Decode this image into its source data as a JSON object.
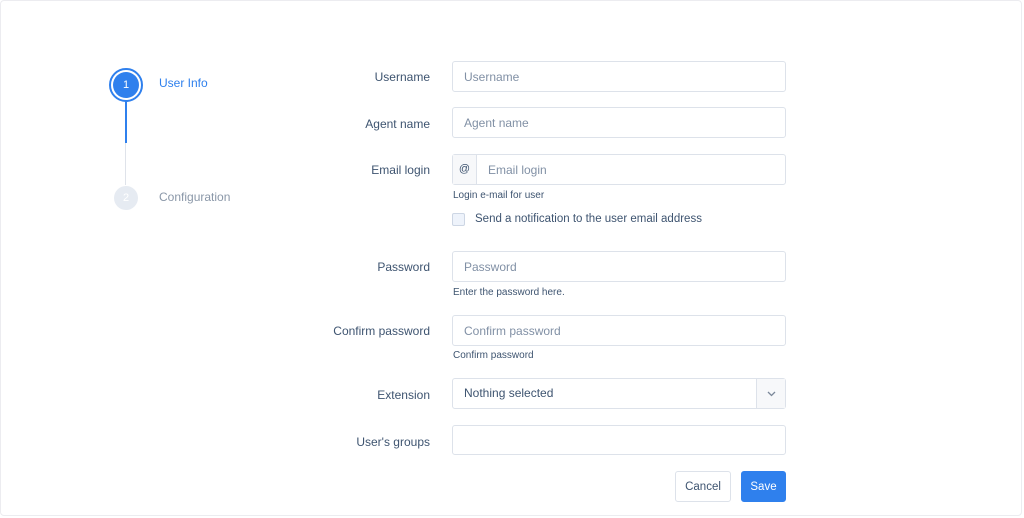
{
  "stepper": {
    "steps": [
      {
        "number": "1",
        "label": "User Info",
        "state": "active"
      },
      {
        "number": "2",
        "label": "Configuration",
        "state": "inactive"
      }
    ]
  },
  "form": {
    "username": {
      "label": "Username",
      "placeholder": "Username",
      "value": ""
    },
    "agent_name": {
      "label": "Agent name",
      "placeholder": "Agent name",
      "value": ""
    },
    "email_login": {
      "label": "Email login",
      "addon": "@",
      "placeholder": "Email login",
      "value": "",
      "help": "Login e-mail for user"
    },
    "notify": {
      "label": "Send a notification to the user email address",
      "checked": false
    },
    "password": {
      "label": "Password",
      "placeholder": "Password",
      "value": "",
      "help": "Enter the password here."
    },
    "confirm_password": {
      "label": "Confirm password",
      "placeholder": "Confirm password",
      "value": "",
      "help": "Confirm password"
    },
    "extension": {
      "label": "Extension",
      "selected": "Nothing selected"
    },
    "user_groups": {
      "label": "User's groups",
      "value": ""
    }
  },
  "actions": {
    "cancel": "Cancel",
    "save": "Save"
  },
  "colors": {
    "accent": "#2f80ed",
    "text": "#3e5470",
    "border": "#dde2ea",
    "muted": "#8a97a8"
  },
  "icons": {
    "select_caret": "chevron-down-icon"
  }
}
